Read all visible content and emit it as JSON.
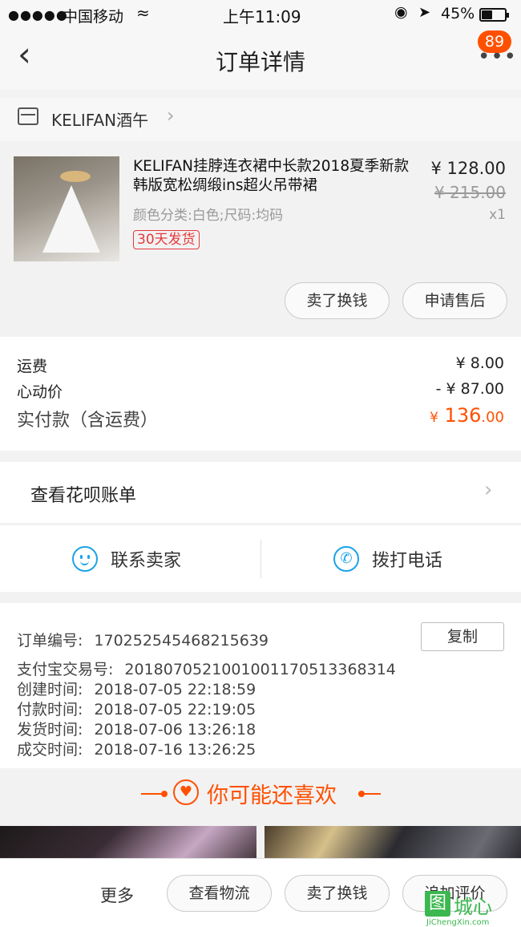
{
  "status_bar": {
    "signal": "●●●●●",
    "carrier": "中国移动",
    "wifi_icon": "wifi-icon",
    "time": "上午11:09",
    "battery": "45%"
  },
  "nav": {
    "back": "‹",
    "title": "订单详情",
    "more": "•••",
    "badge": "89"
  },
  "shop": {
    "name": "KELIFAN酒午",
    "chevron": "›"
  },
  "product": {
    "title": "KELIFAN挂脖连衣裙中长款2018夏季新款韩版宽松绸缎ins超火吊带裙",
    "sku": "颜色分类:白色;尺码:均码",
    "tag": "30天发货",
    "price": "¥ 128.00",
    "original_price": "¥ 215.00",
    "quantity": "x1",
    "buttons": {
      "sell": "卖了换钱",
      "after_sale": "申请售后"
    }
  },
  "fees": {
    "shipping_label": "运费",
    "shipping_value": "¥ 8.00",
    "discount_label": "心动价",
    "discount_value": "- ¥ 87.00",
    "paid_label": "实付款（含运费）",
    "paid_symbol": "¥",
    "paid_int": "136",
    "paid_dec": ".00"
  },
  "huabei": {
    "label": "查看花呗账单",
    "chevron": "›"
  },
  "contact": {
    "seller": "联系卖家",
    "call": "拨打电话"
  },
  "order_info": {
    "copy_button": "复制",
    "rows": [
      {
        "label": "订单编号:",
        "value": "170252545468215639"
      },
      {
        "label": "支付宝交易号:",
        "value": "2018070521001001170513368314"
      },
      {
        "label": "创建时间:",
        "value": "2018-07-05 22:18:59"
      },
      {
        "label": "付款时间:",
        "value": "2018-07-05 22:19:05"
      },
      {
        "label": "发货时间:",
        "value": "2018-07-06 13:26:18"
      },
      {
        "label": "成交时间:",
        "value": "2018-07-16 13:26:25"
      }
    ]
  },
  "recommend": {
    "title": "你可能还喜欢"
  },
  "bottom_bar": {
    "more": "更多",
    "logistics": "查看物流",
    "sell": "卖了换钱",
    "review": "追加评价"
  },
  "watermark": {
    "logo": "图",
    "text": "城心",
    "sub": "JiChengXin.com"
  },
  "colors": {
    "accent": "#ff5000",
    "link_blue": "#1aa3e8",
    "tag_red": "#e4393c"
  }
}
